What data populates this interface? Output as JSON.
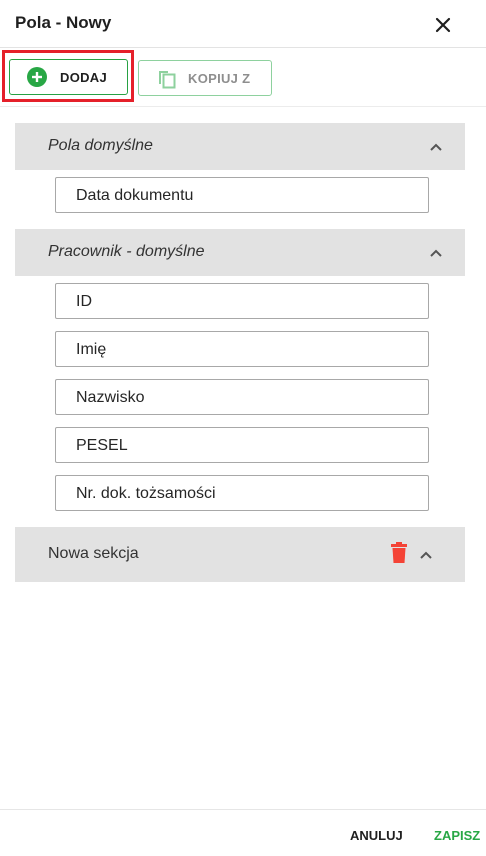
{
  "dialog": {
    "title": "Pola - Nowy"
  },
  "toolbar": {
    "add_label": "DODAJ",
    "copy_label": "KOPIUJ Z"
  },
  "sections": [
    {
      "title": "Pola domyślne",
      "fields": [
        "Data dokumentu"
      ]
    },
    {
      "title": "Pracownik - domyślne",
      "fields": [
        "ID",
        "Imię",
        "Nazwisko",
        "PESEL",
        "Nr. dok. tożsamości"
      ]
    },
    {
      "title": "Nowa sekcja",
      "fields": []
    }
  ],
  "footer": {
    "cancel_label": "ANULUJ",
    "save_label": "ZAPISZ"
  },
  "colors": {
    "accent_green": "#28a745",
    "highlight_red": "#e5202a",
    "delete_red": "#f44336",
    "section_bg": "#e2e2e2"
  },
  "icons": {
    "close": "close-icon",
    "add": "plus-circle-icon",
    "copy": "copy-icon",
    "collapse": "chevron-up-icon",
    "delete": "trash-icon"
  }
}
